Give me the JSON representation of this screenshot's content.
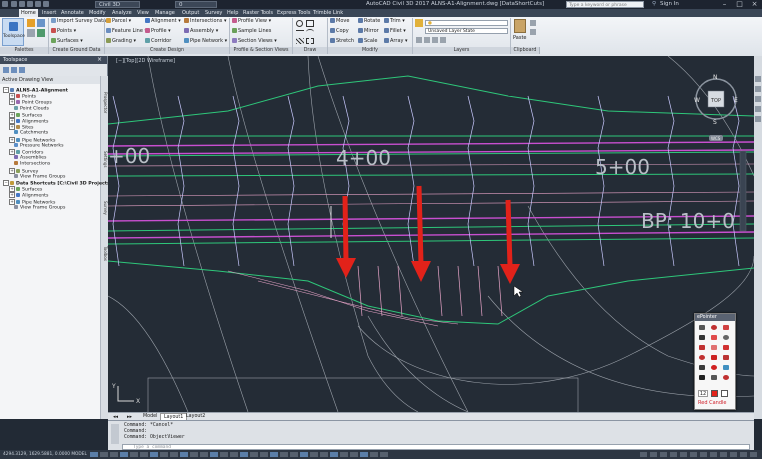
{
  "title_bar": {
    "workspace": "Civil 3D",
    "layer_count": "0",
    "title": "AutoCAD Civil 3D 2017   ALNS-A1-Alignment.dwg [DataShortCuts]",
    "search_placeholder": "Type a keyword or phrase",
    "signin": "Sign In"
  },
  "menu": [
    "Home",
    "Insert",
    "Annotate",
    "Modify",
    "Analyze",
    "View",
    "Manage",
    "Output",
    "Survey",
    "Help",
    "Raster Tools",
    "Express Tools",
    "Trimble Link"
  ],
  "ribbon": {
    "toolspace": "Toolspace",
    "palettes": "Palettes",
    "import_survey": "Import Survey Data",
    "points": "Points",
    "surfaces": "Surfaces",
    "create_ground": "Create Ground Data",
    "parcel": "Parcel",
    "feature_line": "Feature Line",
    "grading": "Grading",
    "alignment": "Alignment",
    "profile": "Profile",
    "corridor": "Corridor",
    "intersections": "Intersections",
    "assembly": "Assembly",
    "pipe_network": "Pipe Network",
    "create_design": "Create Design",
    "profile_view": "Profile View",
    "sample_lines": "Sample Lines",
    "section_views": "Section Views",
    "profile_section": "Profile & Section Views",
    "draw": "Draw",
    "move": "Move",
    "copy": "Copy",
    "stretch": "Stretch",
    "rotate": "Rotate",
    "mirror": "Mirror",
    "scale": "Scale",
    "trim": "Trim",
    "fillet": "Fillet",
    "array": "Array",
    "modify": "Modify",
    "layer_state": "Unsaved Layer State",
    "layers": "Layers",
    "paste": "Paste",
    "clipboard": "Clipboard"
  },
  "toolspace": {
    "header": "Toolspace",
    "view_select": "Active Drawing View",
    "items": [
      {
        "label": "ALNS-A1-Alignment",
        "level": 0,
        "pm": "−"
      },
      {
        "label": "Points",
        "level": 1,
        "pm": "+"
      },
      {
        "label": "Point Groups",
        "level": 1,
        "pm": "+"
      },
      {
        "label": "Point Clouds",
        "level": 1,
        "pm": ""
      },
      {
        "label": "Surfaces",
        "level": 1,
        "pm": "+"
      },
      {
        "label": "Alignments",
        "level": 1,
        "pm": "+"
      },
      {
        "label": "Sites",
        "level": 1,
        "pm": "+"
      },
      {
        "label": "Catchments",
        "level": 1,
        "pm": ""
      },
      {
        "label": "Pipe Networks",
        "level": 1,
        "pm": "+"
      },
      {
        "label": "Pressure Networks",
        "level": 1,
        "pm": ""
      },
      {
        "label": "Corridors",
        "level": 1,
        "pm": "+"
      },
      {
        "label": "Assemblies",
        "level": 1,
        "pm": ""
      },
      {
        "label": "Intersections",
        "level": 1,
        "pm": ""
      },
      {
        "label": "Survey",
        "level": 1,
        "pm": "+"
      },
      {
        "label": "View Frame Groups",
        "level": 1,
        "pm": ""
      },
      {
        "label": "Data Shortcuts [C:\\Civil 3D Projects\\C...",
        "level": 0,
        "pm": "−"
      },
      {
        "label": "Surfaces",
        "level": 1,
        "pm": "+"
      },
      {
        "label": "Alignments",
        "level": 1,
        "pm": "+"
      },
      {
        "label": "Pipe Networks",
        "level": 1,
        "pm": "+"
      },
      {
        "label": "View Frame Groups",
        "level": 1,
        "pm": ""
      }
    ],
    "vtabs": [
      "Prospector",
      "Settings",
      "Survey",
      "Toolbox"
    ]
  },
  "viewport": {
    "label": "[−][Top][2D Wireframe]",
    "stations": [
      "+00",
      "4+00",
      "5+00",
      "BP: 10+0"
    ],
    "compass": {
      "N": "N",
      "W": "W",
      "E": "E",
      "S": "S",
      "top": "TOP",
      "wcs": "WCS"
    }
  },
  "layout_tabs": [
    "Model",
    "Layout1",
    "Layout2"
  ],
  "command": {
    "lines": [
      "Command: *Cancel*",
      "Command:",
      "Command: ObjectViewer"
    ],
    "placeholder": "Type a command"
  },
  "status_text": "4294.3129, 1629.5881, 0.0000   MODEL",
  "pointer": {
    "title": "ePointer",
    "size": "12",
    "tool": "Red Candle"
  },
  "colors": {
    "background": "#242c36",
    "green": "#2ec77a",
    "magenta": "#c84fd0",
    "pink": "#e8a4c8",
    "white_line": "#bfc5cc",
    "arrow": "#e2221a"
  }
}
